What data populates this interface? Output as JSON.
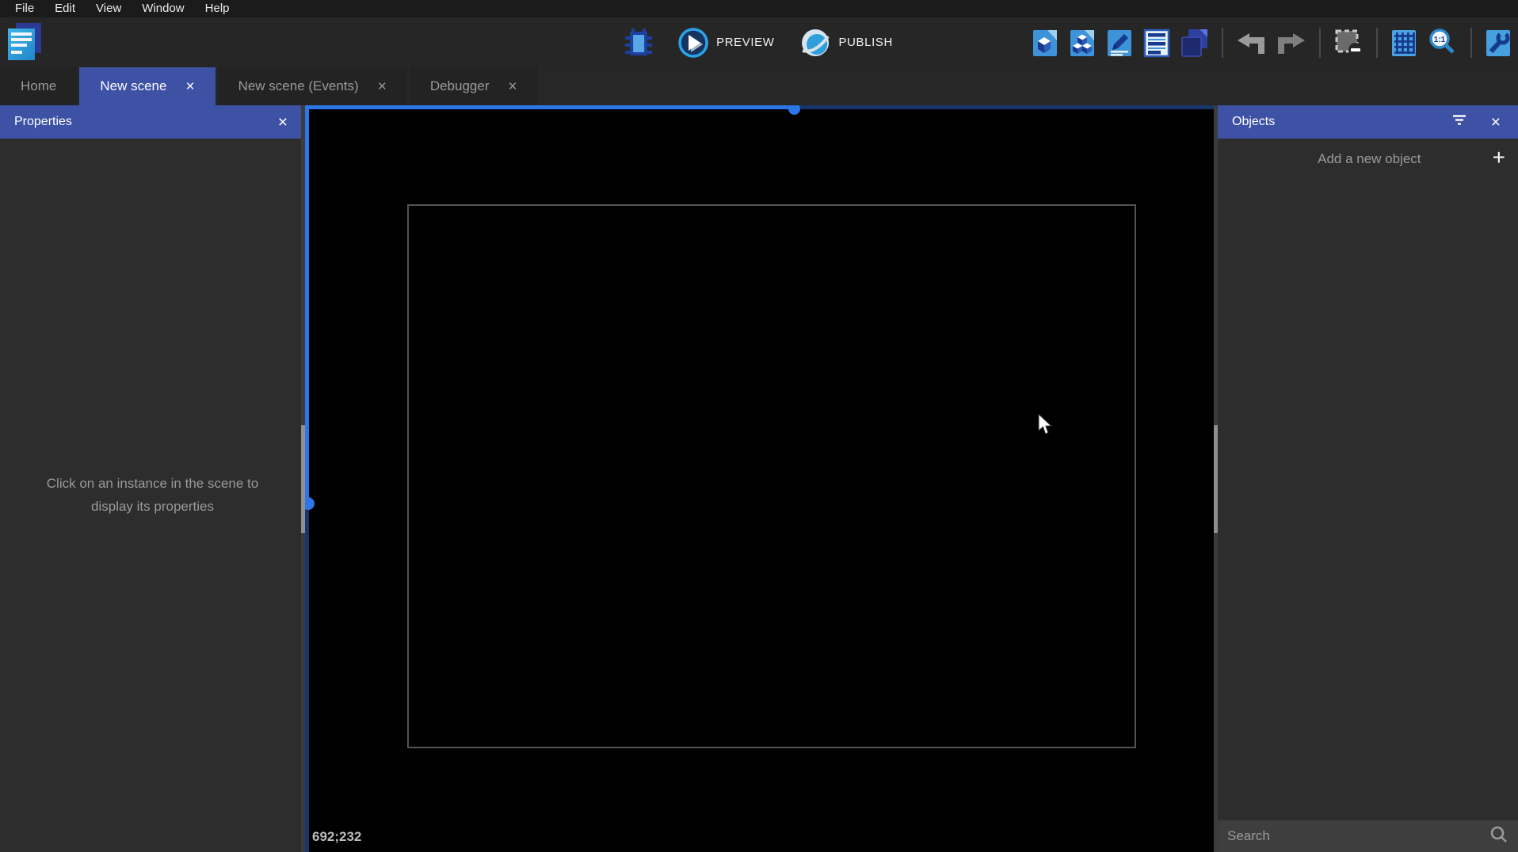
{
  "menu": {
    "items": [
      "File",
      "Edit",
      "View",
      "Window",
      "Help"
    ]
  },
  "toolbar": {
    "preview_label": "PREVIEW",
    "publish_label": "PUBLISH",
    "right_icons": [
      "objects-editor",
      "object-groups-editor",
      "scene-variables",
      "instances-list",
      "layers-editor",
      "undo",
      "redo",
      "clear-selection",
      "toggle-grid",
      "zoom-1-1",
      "scene-properties"
    ]
  },
  "tabs": [
    {
      "label": "Home",
      "active": false,
      "closable": false
    },
    {
      "label": "New scene",
      "active": true,
      "closable": true
    },
    {
      "label": "New scene (Events)",
      "active": false,
      "closable": true
    },
    {
      "label": "Debugger",
      "active": false,
      "closable": true
    }
  ],
  "properties_panel": {
    "title": "Properties",
    "empty_message": "Click on an instance in the scene to display its properties"
  },
  "objects_panel": {
    "title": "Objects",
    "add_label": "Add a new object",
    "search_placeholder": "Search"
  },
  "canvas": {
    "coordinates": "692;232"
  },
  "icons": {
    "close": "×",
    "plus": "+"
  },
  "colors": {
    "accent_header": "#3d51a5",
    "scrollbar_blue": "#2d76e8",
    "scrollbar_navy": "#1a356b",
    "panel_bg": "#2d2d2d",
    "toolbar_bg": "#262626",
    "menubar_bg": "#1b1b1b",
    "canvas_bg": "#000000",
    "scene_rect_border": "#535353",
    "search_bg": "#3e3e3e"
  }
}
